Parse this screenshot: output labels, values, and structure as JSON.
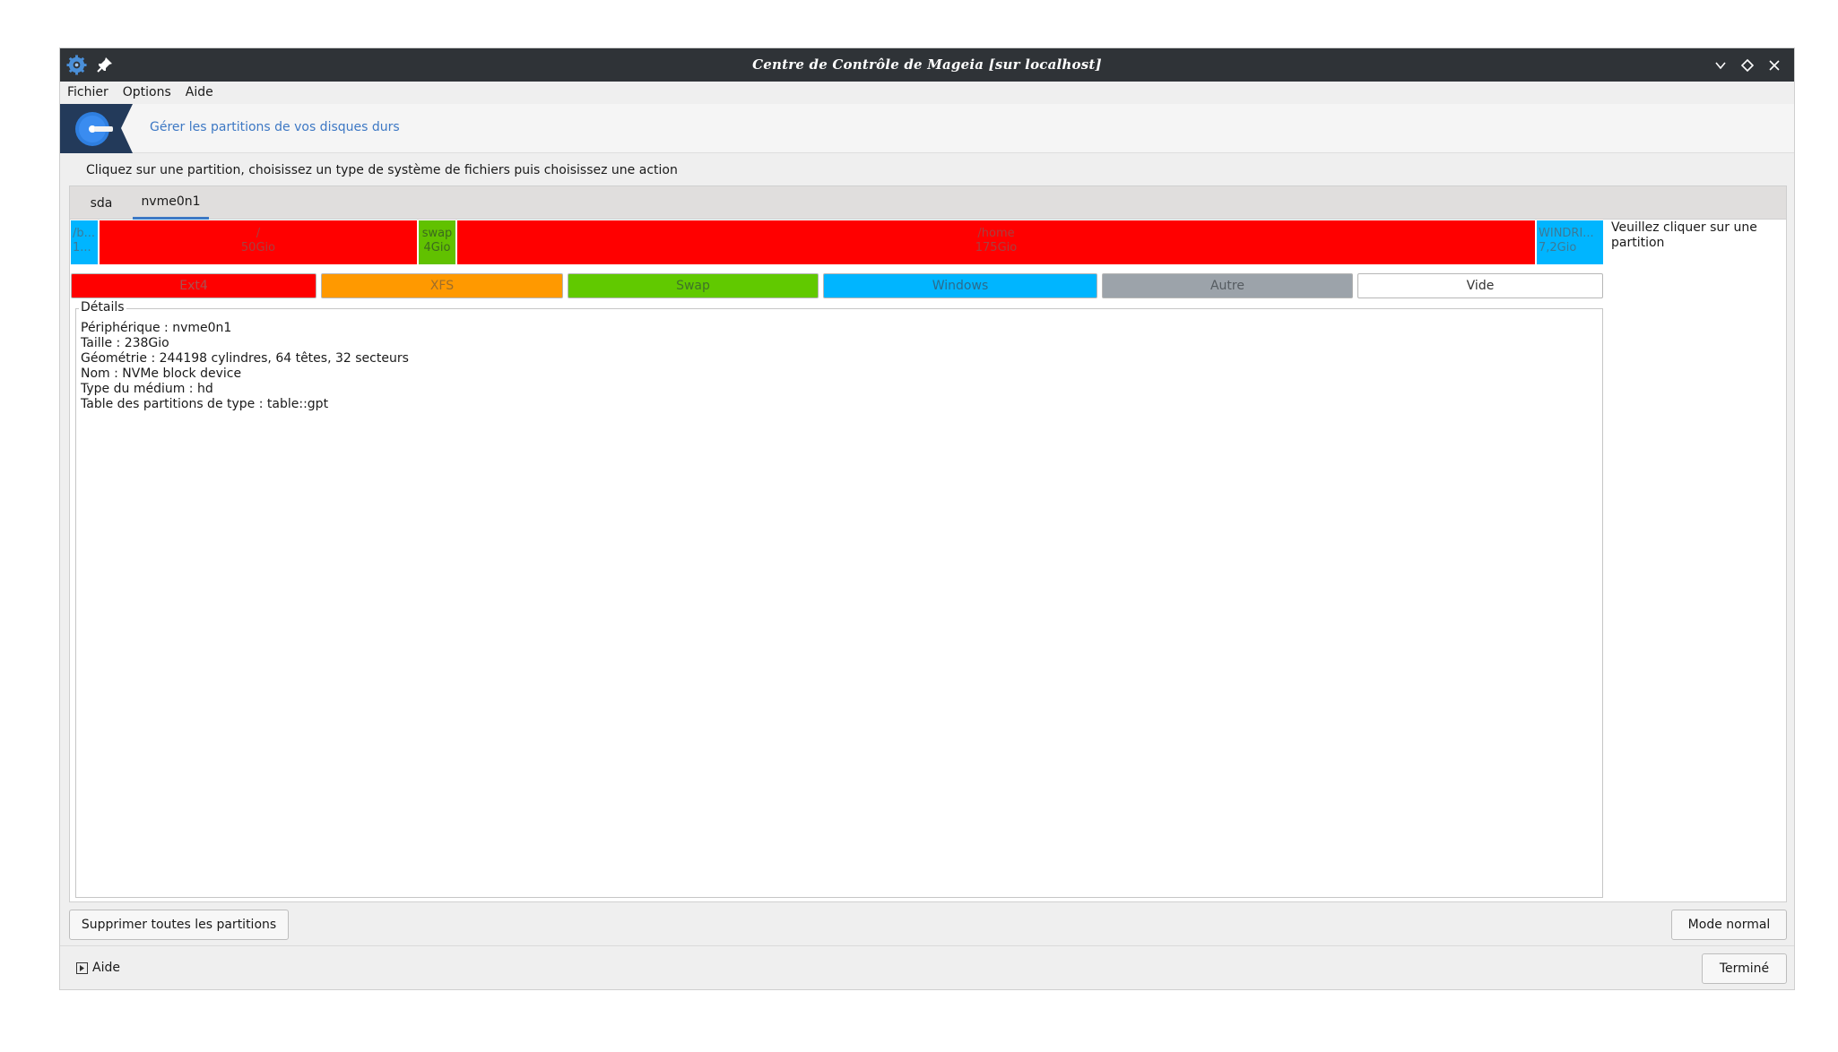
{
  "window": {
    "title": "Centre de Contrôle de Mageia [sur localhost]",
    "icons": [
      "mageia-gear-icon",
      "pin-icon",
      "minimize-icon",
      "maximize-icon",
      "close-icon"
    ]
  },
  "menubar": {
    "items": [
      "Fichier",
      "Options",
      "Aide"
    ]
  },
  "header": {
    "icon": "harddisk-icon",
    "subtitle": "Gérer les partitions de vos disques durs"
  },
  "instruction": "Cliquez sur une partition, choisissez un type de système de fichiers puis choisissez une action",
  "tabs": [
    {
      "label": "sda",
      "active": false
    },
    {
      "label": "nvme0n1",
      "active": true
    }
  ],
  "partitions": [
    {
      "name": "/b...",
      "size": "1...",
      "type": "windows",
      "color": "#00b5ff"
    },
    {
      "name": "/",
      "size": "50Gio",
      "type": "ext4",
      "color": "#ff0000"
    },
    {
      "name": "swap",
      "size": "4Gio",
      "type": "swap",
      "color": "#61c100"
    },
    {
      "name": "/home",
      "size": "175Gio",
      "type": "ext4",
      "color": "#ff0000"
    },
    {
      "name": "WINDRI...",
      "size": "7,2Gio",
      "type": "windows",
      "color": "#00b5ff"
    }
  ],
  "hint": "Veuillez cliquer sur une partition",
  "legend": [
    {
      "label": "Ext4",
      "color": "#ff0000"
    },
    {
      "label": "XFS",
      "color": "#ff9900"
    },
    {
      "label": "Swap",
      "color": "#61c900"
    },
    {
      "label": "Windows",
      "color": "#00b5ff"
    },
    {
      "label": "Autre",
      "color": "#9ca3aa"
    },
    {
      "label": "Vide",
      "color": "#ffffff"
    }
  ],
  "details": {
    "label": "Détails",
    "lines": [
      "Périphérique : nvme0n1",
      "Taille : 238Gio",
      "Géométrie : 244198 cylindres, 64 têtes, 32 secteurs",
      "Nom : NVMe block device",
      "Type du médium : hd",
      "Table des partitions de type : table::gpt"
    ]
  },
  "buttons": {
    "delete_all": "Supprimer toutes les partitions",
    "mode": "Mode normal",
    "done": "Terminé"
  },
  "help": {
    "label": "Aide"
  }
}
